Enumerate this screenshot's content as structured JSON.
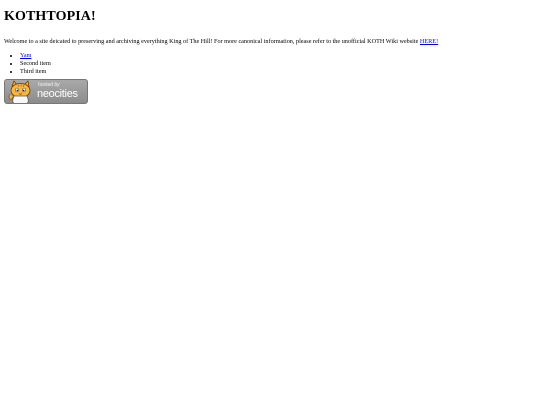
{
  "page": {
    "title": "KOTHTOPIA!",
    "intro_text": "Welcome to a site deicated to preserving and archiving everything King of The Hill! For more canonical information, please refer to the unofficial KOTH Wiki website ",
    "intro_link_label": "HERE!"
  },
  "list": {
    "items": [
      "Yam",
      "Second item",
      "Third item"
    ]
  },
  "badge": {
    "hosted_label": "hosted by",
    "brand_label": "neocities",
    "icon": "neocities-cat-icon"
  },
  "colors": {
    "link": "#0000ee",
    "badge_background": "#9a9a9a",
    "cat_orange": "#f5a623"
  }
}
